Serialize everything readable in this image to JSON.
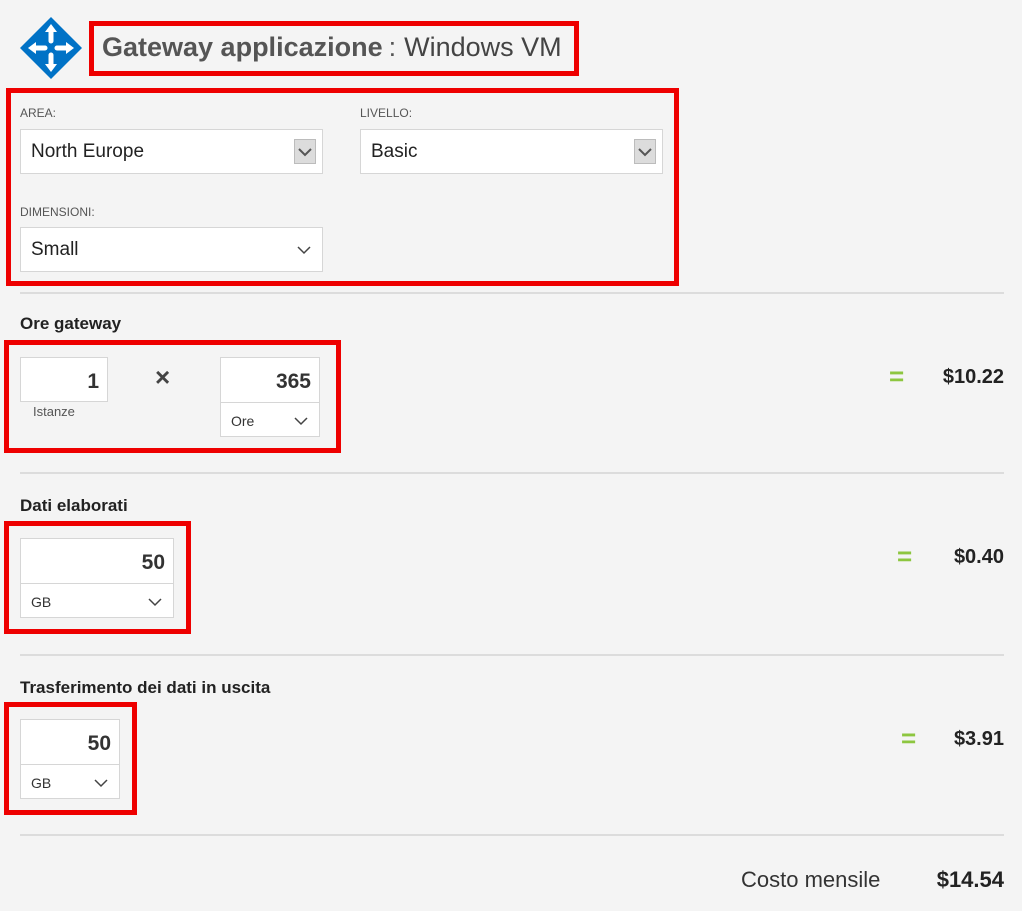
{
  "header": {
    "service": "Gateway applicazione",
    "separator": ":",
    "subtitle": "Windows VM"
  },
  "config": {
    "area_label": "AREA:",
    "area_value": "North Europe",
    "tier_label": "LIVELLO:",
    "tier_value": "Basic",
    "size_label": "DIMENSIONI:",
    "size_value": "Small"
  },
  "gateway_hours": {
    "title": "Ore gateway",
    "instances_value": "1",
    "instances_label": "Istanze",
    "times_symbol": "×",
    "hours_value": "365",
    "hours_unit": "Ore",
    "equals": "=",
    "price": "$10.22"
  },
  "data_processed": {
    "title": "Dati elaborati",
    "value": "50",
    "unit": "GB",
    "equals": "=",
    "price": "$0.40"
  },
  "outbound_transfer": {
    "title": "Trasferimento dei dati in uscita",
    "value": "50",
    "unit": "GB",
    "equals": "=",
    "price": "$3.91"
  },
  "total": {
    "label": "Costo mensile",
    "price": "$14.54"
  },
  "colors": {
    "highlight": "#ee0000",
    "equals_green": "#8dc63f",
    "icon_blue": "#0072c6"
  }
}
